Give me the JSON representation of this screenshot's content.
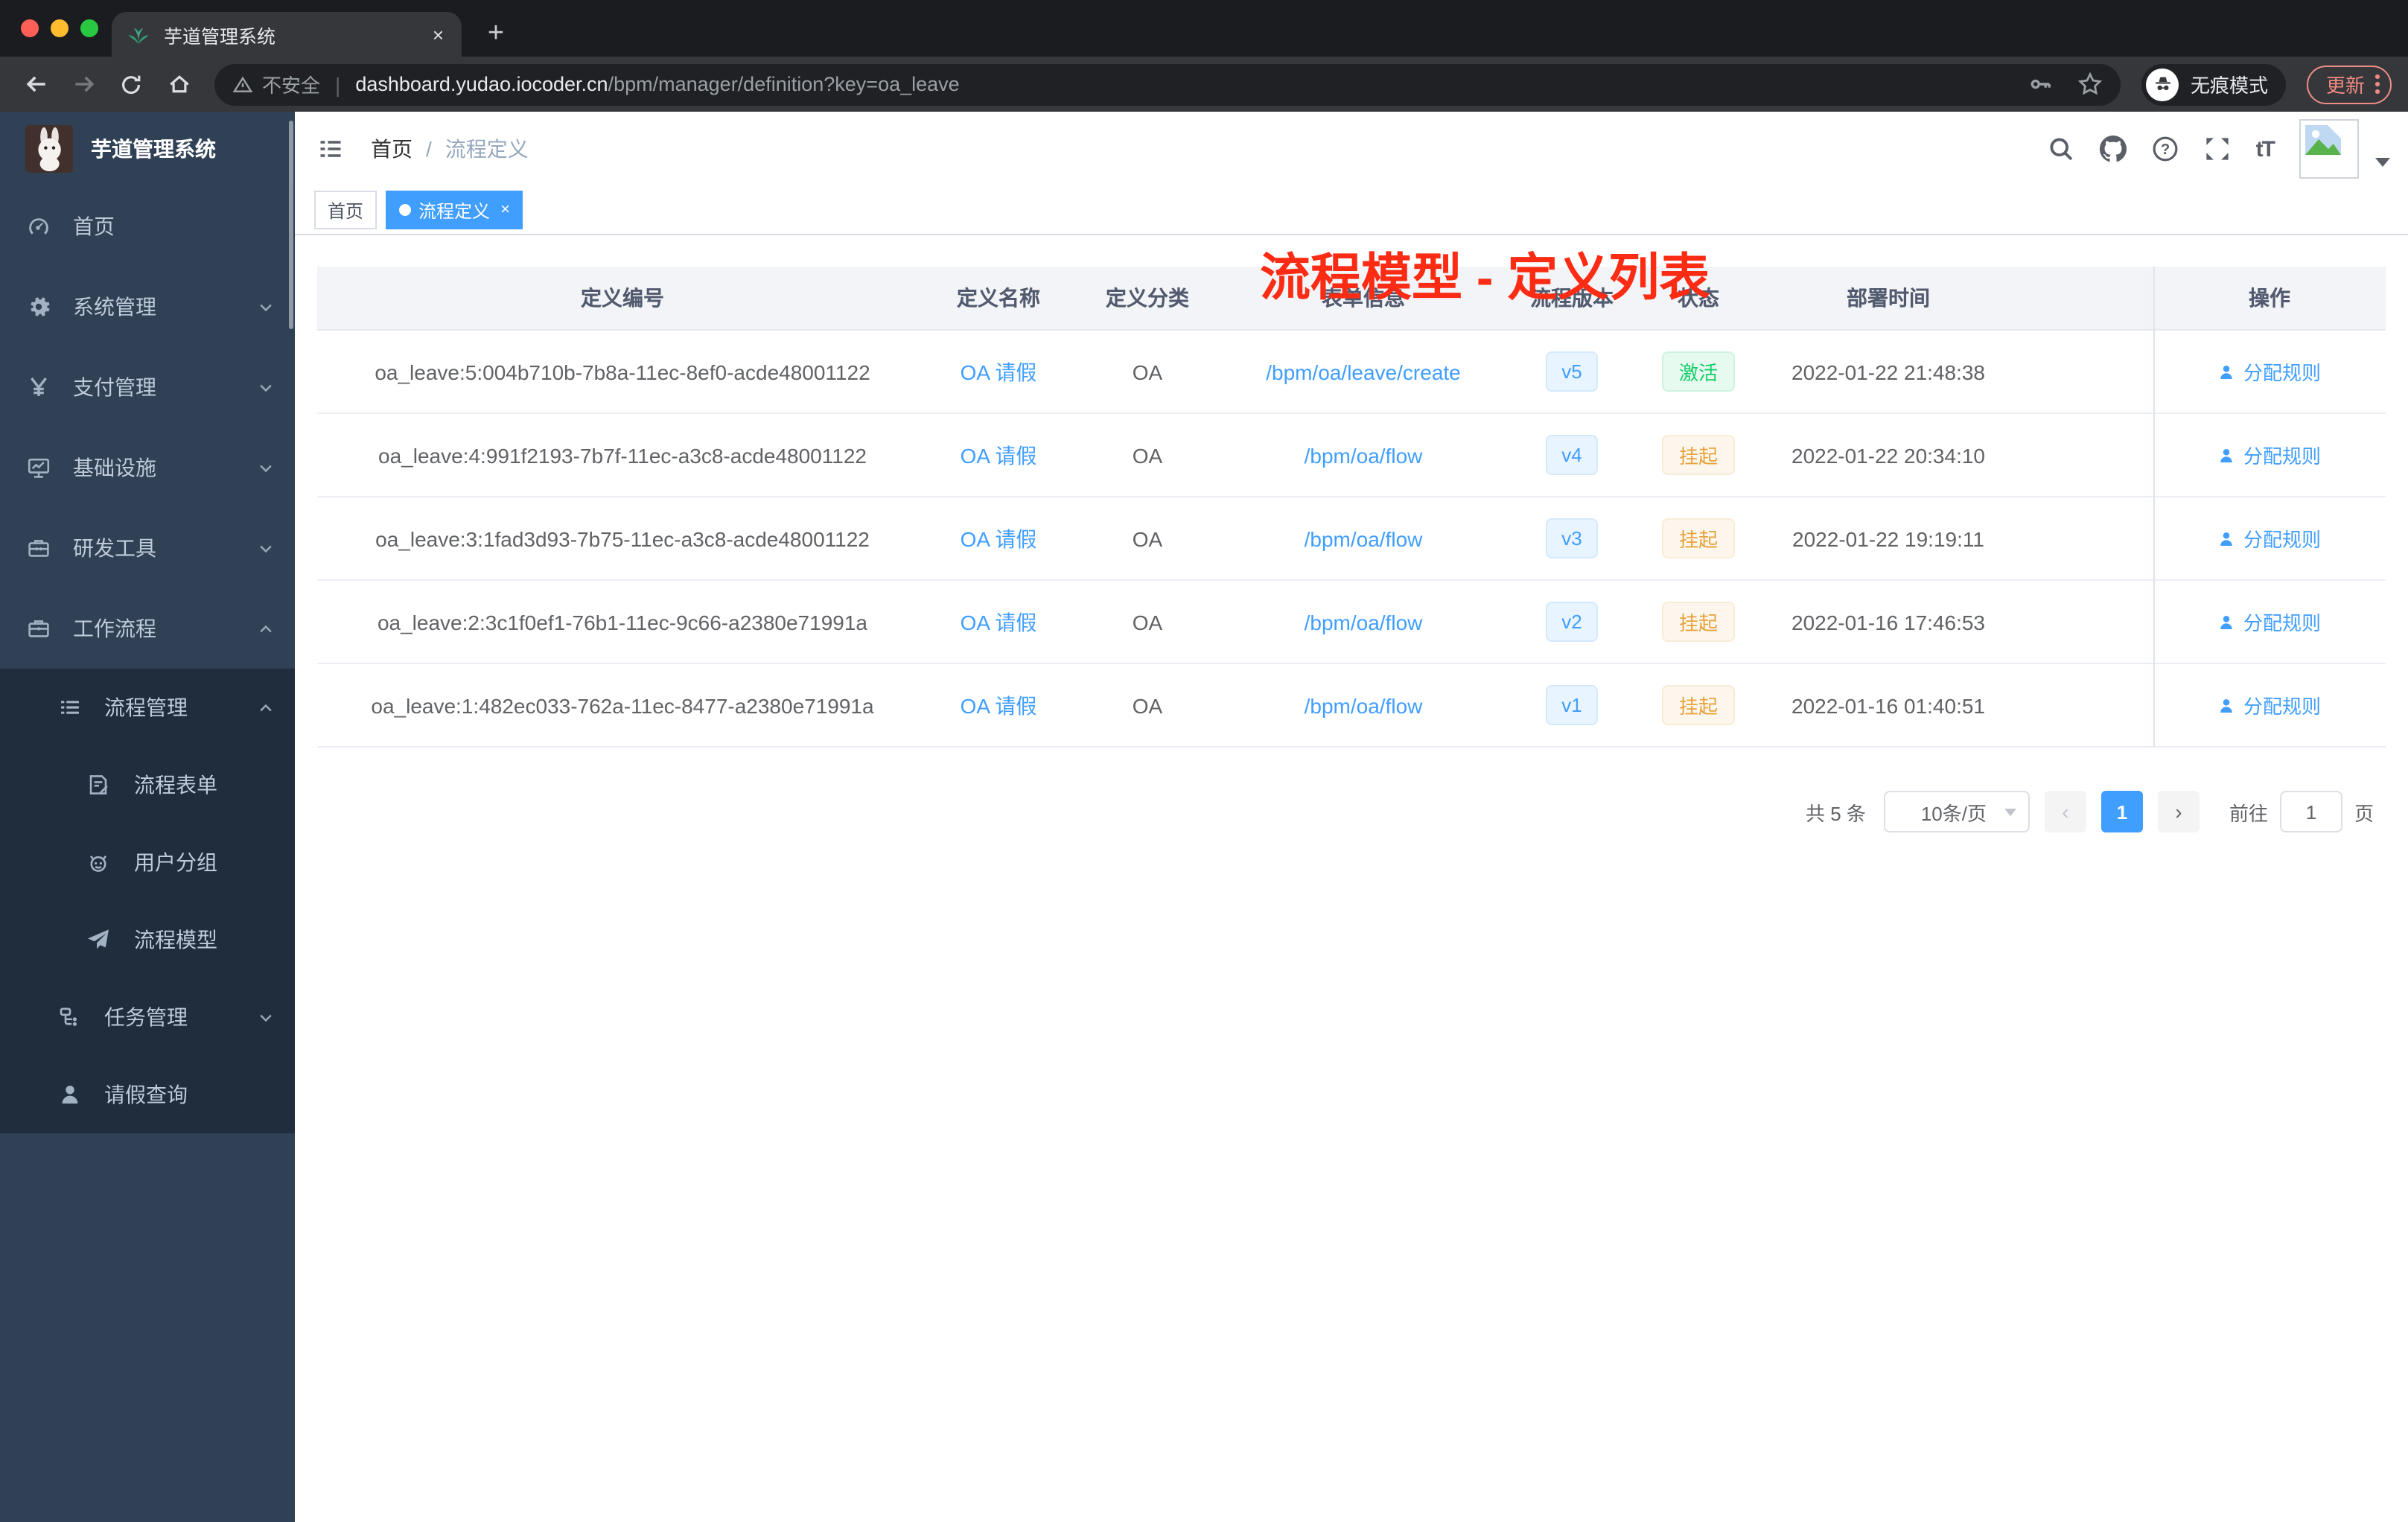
{
  "browser": {
    "tab": {
      "title": "芋道管理系统",
      "close_label": "×"
    },
    "new_tab_label": "+",
    "address": {
      "security_label": "不安全",
      "separator": "|",
      "url_host": "dashboard.yudao.iocoder.cn",
      "url_path": "/bpm/manager/definition?key=oa_leave"
    },
    "incognito_label": "无痕模式",
    "update_label": "更新"
  },
  "sidebar": {
    "logo_title": "芋道管理系统",
    "menu": [
      {
        "label": "首页",
        "icon": "dashboard-icon",
        "level": 1,
        "arrow": null,
        "submenu": false
      },
      {
        "label": "系统管理",
        "icon": "gear-icon",
        "level": 1,
        "arrow": "down",
        "submenu": false
      },
      {
        "label": "支付管理",
        "icon": "yen-icon",
        "level": 1,
        "arrow": "down",
        "submenu": false
      },
      {
        "label": "基础设施",
        "icon": "monitor-icon",
        "level": 1,
        "arrow": "down",
        "submenu": false
      },
      {
        "label": "研发工具",
        "icon": "toolbox-icon",
        "level": 1,
        "arrow": "down",
        "submenu": false
      },
      {
        "label": "工作流程",
        "icon": "briefcase-icon",
        "level": 1,
        "arrow": "up",
        "submenu": false
      },
      {
        "label": "流程管理",
        "icon": "list-tree-icon",
        "level": 2,
        "arrow": "up",
        "submenu": true
      },
      {
        "label": "流程表单",
        "icon": "form-icon",
        "level": 3,
        "arrow": null,
        "submenu": true
      },
      {
        "label": "用户分组",
        "icon": "robot-icon",
        "level": 3,
        "arrow": null,
        "submenu": true
      },
      {
        "label": "流程模型",
        "icon": "paper-plane-icon",
        "level": 3,
        "arrow": null,
        "submenu": true
      },
      {
        "label": "任务管理",
        "icon": "org-tree-icon",
        "level": 2,
        "arrow": "down",
        "submenu": true
      },
      {
        "label": "请假查询",
        "icon": "user-icon",
        "level": 2,
        "arrow": null,
        "submenu": true
      }
    ]
  },
  "header": {
    "breadcrumb": [
      "首页",
      "流程定义"
    ],
    "breadcrumb_separator": "/",
    "annotation": "流程模型 - 定义列表",
    "font_icon_label": "tT"
  },
  "tags": [
    {
      "label": "首页",
      "active": false
    },
    {
      "label": "流程定义",
      "active": true,
      "close_label": "×"
    }
  ],
  "table": {
    "columns": [
      "定义编号",
      "定义名称",
      "定义分类",
      "表单信息",
      "流程版本",
      "状态",
      "部署时间",
      "操作"
    ],
    "rows": [
      {
        "id": "oa_leave:5:004b710b-7b8a-11ec-8ef0-acde48001122",
        "name": "OA 请假",
        "category": "OA",
        "form": "/bpm/oa/leave/create",
        "version": "v5",
        "status": "激活",
        "status_type": "success",
        "deploy_time": "2022-01-22 21:48:38",
        "action": "分配规则"
      },
      {
        "id": "oa_leave:4:991f2193-7b7f-11ec-a3c8-acde48001122",
        "name": "OA 请假",
        "category": "OA",
        "form": "/bpm/oa/flow",
        "version": "v4",
        "status": "挂起",
        "status_type": "warning",
        "deploy_time": "2022-01-22 20:34:10",
        "action": "分配规则"
      },
      {
        "id": "oa_leave:3:1fad3d93-7b75-11ec-a3c8-acde48001122",
        "name": "OA 请假",
        "category": "OA",
        "form": "/bpm/oa/flow",
        "version": "v3",
        "status": "挂起",
        "status_type": "warning",
        "deploy_time": "2022-01-22 19:19:11",
        "action": "分配规则"
      },
      {
        "id": "oa_leave:2:3c1f0ef1-76b1-11ec-9c66-a2380e71991a",
        "name": "OA 请假",
        "category": "OA",
        "form": "/bpm/oa/flow",
        "version": "v2",
        "status": "挂起",
        "status_type": "warning",
        "deploy_time": "2022-01-16 17:46:53",
        "action": "分配规则"
      },
      {
        "id": "oa_leave:1:482ec033-762a-11ec-8477-a2380e71991a",
        "name": "OA 请假",
        "category": "OA",
        "form": "/bpm/oa/flow",
        "version": "v1",
        "status": "挂起",
        "status_type": "warning",
        "deploy_time": "2022-01-16 01:40:51",
        "action": "分配规则"
      }
    ]
  },
  "pagination": {
    "total": "共 5 条",
    "page_size": "10条/页",
    "prev_label": "‹",
    "page": "1",
    "next_label": "›",
    "goto_label": "前往",
    "goto_value": "1",
    "unit_label": "页"
  },
  "colors": {
    "accent_blue": "#409eff",
    "annotation_red": "#fc2b14",
    "status_active_green": "#13ce66",
    "status_suspend_orange": "#e6a23c",
    "sidebar_bg": "#304156",
    "submenu_bg": "#1f2d3d",
    "tag_active_bg": "#409eff"
  }
}
